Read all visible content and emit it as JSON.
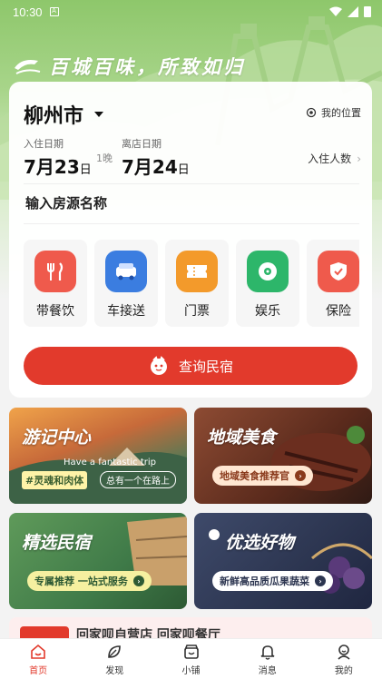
{
  "status_bar": {
    "time": "10:30",
    "sim_label": "A"
  },
  "slogan": "百城百味，所致如归",
  "search": {
    "city": "柳州市",
    "location_label": "我的位置",
    "checkin_label": "入住日期",
    "checkin_month": "7月",
    "checkin_day": "23",
    "checkin_unit": "日",
    "nights": "1晚",
    "checkout_label": "离店日期",
    "checkout_month": "7月",
    "checkout_day": "24",
    "checkout_unit": "日",
    "guests_label": "入住人数",
    "name_placeholder": "输入房源名称",
    "query_button": "查询民宿"
  },
  "services": [
    {
      "label": "带餐饮",
      "icon": "dining-icon",
      "color": "#ef5a4c"
    },
    {
      "label": "车接送",
      "icon": "car-icon",
      "color": "#3b7de0"
    },
    {
      "label": "门票",
      "icon": "ticket-icon",
      "color": "#f39a2b"
    },
    {
      "label": "娱乐",
      "icon": "music-icon",
      "color": "#2db66a"
    },
    {
      "label": "保险",
      "icon": "insurance-icon",
      "color": "#ef5a4c"
    }
  ],
  "tiles": [
    {
      "title": "游记中心",
      "subtitle": "Have a fantastic trip",
      "tag": "#灵魂和肉体",
      "tag2": "总有一个在路上"
    },
    {
      "title": "地域美食",
      "button": "地域美食推荐官"
    },
    {
      "title": "精选民宿",
      "button": "专属推荐 一站式服务"
    },
    {
      "title": "优选好物",
      "button": "新鲜高品质瓜果蔬菜"
    }
  ],
  "peek": {
    "text": "回家呗自营店 回家呗餐厅"
  },
  "tabbar": [
    {
      "label": "首页",
      "icon": "home-icon",
      "active": true
    },
    {
      "label": "发现",
      "icon": "leaf-icon",
      "active": false
    },
    {
      "label": "小铺",
      "icon": "shop-icon",
      "active": false
    },
    {
      "label": "消息",
      "icon": "bell-icon",
      "active": false
    },
    {
      "label": "我的",
      "icon": "user-icon",
      "active": false
    }
  ],
  "colors": {
    "accent": "#e23a2c",
    "header_green": "#8ec76b"
  }
}
